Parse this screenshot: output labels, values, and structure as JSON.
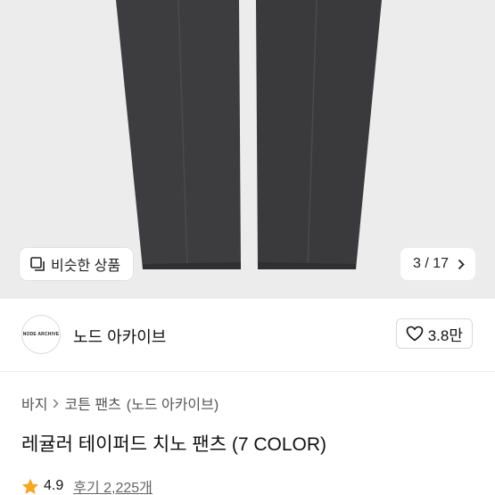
{
  "gallery": {
    "similar_label": "비슷한 상품",
    "counter": "3 / 17"
  },
  "brand": {
    "logo_text": "NODE ARCHIVE",
    "name": "노드 아카이브",
    "likes": "3.8만"
  },
  "breadcrumb": {
    "items": [
      "바지",
      "코튼 팬츠",
      "(노드 아카이브)"
    ]
  },
  "product": {
    "title": "레귤러 테이퍼드 치노 팬츠 (7 COLOR)",
    "rating": "4.9",
    "reviews": "후기 2,225개"
  },
  "colors": {
    "star": "#f5a623",
    "gallery_bg": "#ececec",
    "pants": "#3d3d3f"
  }
}
